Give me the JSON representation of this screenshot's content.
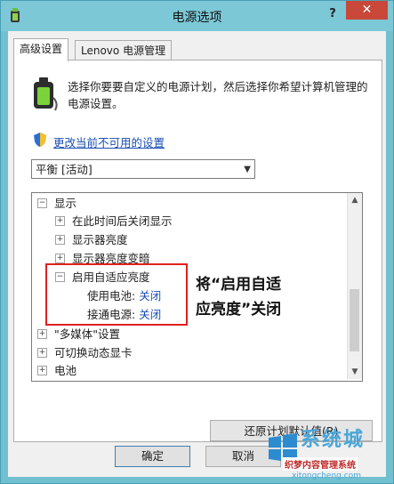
{
  "window": {
    "title": "电源选项",
    "help": "?",
    "close": "✕"
  },
  "tabs": [
    "高级设置",
    "Lenovo 电源管理"
  ],
  "description": "选择你要要自定义的电源计划，然后选择你希望计算机管理的电源设置。",
  "change_link": "更改当前不可用的设置",
  "plan_select": {
    "value": "平衡 [活动]"
  },
  "tree": {
    "display": "显示",
    "turn_off": "在此时间后关闭显示",
    "brightness": "显示器亮度",
    "dim_brightness": "显示器亮度变暗",
    "adaptive": "启用自适应亮度",
    "on_battery_label": "使用电池:",
    "on_battery_value": "关闭",
    "plugged_label": "接通电源:",
    "plugged_value": "关闭",
    "multimedia": "\"多媒体\"设置",
    "switchable": "可切换动态显卡",
    "battery": "电池"
  },
  "annotation": {
    "line1": "将“启用自适",
    "line2": "应亮度”关闭"
  },
  "buttons": {
    "restore": "还原计划默认值(R)",
    "ok": "确定",
    "cancel": "取消"
  },
  "watermark": {
    "brand": "系统城",
    "sub": "织梦内容管理系统",
    "url": "xitongcheng.com"
  }
}
